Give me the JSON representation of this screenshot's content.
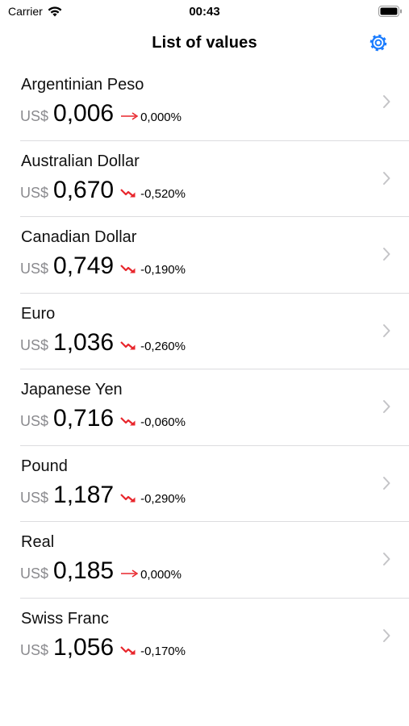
{
  "status_bar": {
    "carrier": "Carrier",
    "time": "00:43"
  },
  "nav": {
    "title": "List of values",
    "settings_icon": "gear-icon"
  },
  "colors": {
    "accent": "#1a7cff",
    "trend_red": "#e8262c",
    "secondary_text": "#8a8a8e"
  },
  "list": {
    "items": [
      {
        "name": "Argentinian Peso",
        "currency": "US$",
        "value": "0,006",
        "trend": "flat",
        "change": "0,000%"
      },
      {
        "name": "Australian Dollar",
        "currency": "US$",
        "value": "0,670",
        "trend": "down",
        "change": "-0,520%"
      },
      {
        "name": "Canadian Dollar",
        "currency": "US$",
        "value": "0,749",
        "trend": "down",
        "change": "-0,190%"
      },
      {
        "name": "Euro",
        "currency": "US$",
        "value": "1,036",
        "trend": "down",
        "change": "-0,260%"
      },
      {
        "name": "Japanese Yen",
        "currency": "US$",
        "value": "0,716",
        "trend": "down",
        "change": "-0,060%"
      },
      {
        "name": "Pound",
        "currency": "US$",
        "value": "1,187",
        "trend": "down",
        "change": "-0,290%"
      },
      {
        "name": "Real",
        "currency": "US$",
        "value": "0,185",
        "trend": "flat",
        "change": "0,000%"
      },
      {
        "name": "Swiss Franc",
        "currency": "US$",
        "value": "1,056",
        "trend": "down",
        "change": "-0,170%"
      }
    ]
  }
}
